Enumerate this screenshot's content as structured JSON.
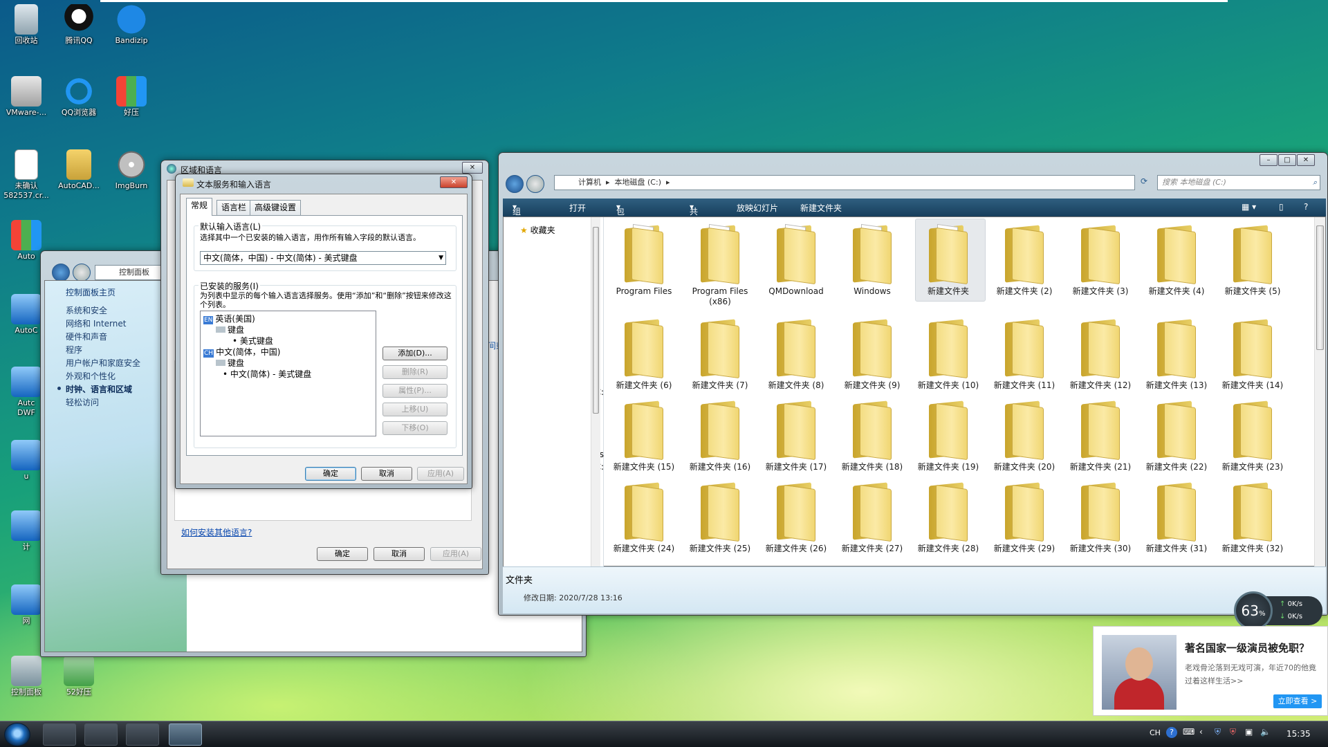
{
  "desktop": {
    "icons": [
      {
        "label": "回收站",
        "icon": "recycle-bin-icon"
      },
      {
        "label": "腾讯QQ",
        "icon": "qq-icon"
      },
      {
        "label": "Bandizip",
        "icon": "bandizip-icon"
      },
      {
        "label": "VMware-...",
        "icon": "vmware-icon"
      },
      {
        "label": "QQ浏览器",
        "icon": "qq-browser-icon"
      },
      {
        "label": "好压",
        "icon": "haozip-icon"
      },
      {
        "label": "未确认\n582537.cr...",
        "icon": "document-icon"
      },
      {
        "label": "AutoCAD...",
        "icon": "autocad-folder-icon"
      },
      {
        "label": "ImgBurn",
        "icon": "imgburn-icon"
      },
      {
        "label": "Auto",
        "icon": "autocad-icon"
      },
      {
        "label": "AutoC",
        "icon": "autocad-icon"
      },
      {
        "label": "Autc\nDWF",
        "icon": "dwf-icon"
      },
      {
        "label": "u",
        "icon": "app-icon"
      },
      {
        "label": "计",
        "icon": "computer-icon"
      },
      {
        "label": "网",
        "icon": "network-icon"
      },
      {
        "label": "控制面板",
        "icon": "control-panel-icon"
      },
      {
        "label": "52好压",
        "icon": "haozip-icon"
      }
    ]
  },
  "control_panel": {
    "address": "控制面板",
    "sidebar": [
      {
        "label": "控制面板主页"
      },
      {
        "label": "系统和安全"
      },
      {
        "label": "网络和 Internet"
      },
      {
        "label": "硬件和声音"
      },
      {
        "label": "程序"
      },
      {
        "label": "用户帐户和家庭安全"
      },
      {
        "label": "外观和个性化"
      },
      {
        "label": "时钟、语言和区域"
      },
      {
        "label": "轻松访问"
      }
    ],
    "link_fragment": "间或数字格式"
  },
  "region_dialog": {
    "title": "区域和语言",
    "link": "如何安装其他语言?",
    "ok": "确定",
    "cancel": "取消",
    "apply": "应用(A)"
  },
  "text_services": {
    "title": "文本服务和输入语言",
    "tabs": [
      "常规",
      "语言栏",
      "高级键设置"
    ],
    "default_group": "默认输入语言(L)",
    "default_desc": "选择其中一个已安装的输入语言，用作所有输入字段的默认语言。",
    "default_value": "中文(简体，中国) - 中文(简体) - 美式键盘",
    "installed_group": "已安装的服务(I)",
    "installed_desc": "为列表中显示的每个输入语言选择服务。使用“添加”和“删除”按钮来修改这个列表。",
    "tree": [
      {
        "text": "英语(美国)",
        "flag": "EN"
      },
      {
        "text": "键盘"
      },
      {
        "text": "美式键盘"
      },
      {
        "text": "中文(简体，中国)",
        "flag": "CH"
      },
      {
        "text": "键盘"
      },
      {
        "text": "中文(简体) - 美式键盘"
      }
    ],
    "buttons": {
      "add": "添加(D)...",
      "remove": "删除(R)",
      "properties": "属性(P)...",
      "move_up": "上移(U)",
      "move_down": "下移(O)"
    },
    "ok": "确定",
    "cancel": "取消",
    "apply": "应用(A)"
  },
  "explorer": {
    "breadcrumb": [
      "计算机",
      "本地磁盘 (C:)"
    ],
    "search_placeholder": "搜索 本地磁盘 (C:)",
    "toolbar": [
      "组织",
      "打开",
      "包含到库中",
      "共享",
      "放映幻灯片",
      "新建文件夹"
    ],
    "nav": {
      "favorites": "收藏夹",
      "fragments": [
        "置",
        "(C:",
        "les",
        "(C:"
      ]
    },
    "folders": [
      "Program Files",
      "Program Files\n(x86)",
      "QMDownload",
      "Windows",
      "新建文件夹",
      "新建文件夹 (2)",
      "新建文件夹 (3)",
      "新建文件夹 (4)",
      "新建文件夹 (5)",
      "新建文件夹 (6)",
      "新建文件夹 (7)",
      "新建文件夹 (8)",
      "新建文件夹 (9)",
      "新建文件夹 (10)",
      "新建文件夹 (11)",
      "新建文件夹 (12)",
      "新建文件夹 (13)",
      "新建文件夹 (14)",
      "新建文件夹 (15)",
      "新建文件夹 (16)",
      "新建文件夹 (17)",
      "新建文件夹 (18)",
      "新建文件夹 (19)",
      "新建文件夹 (20)",
      "新建文件夹 (21)",
      "新建文件夹 (22)",
      "新建文件夹 (23)",
      "新建文件夹 (24)",
      "新建文件夹 (25)",
      "新建文件夹 (26)",
      "新建文件夹 (27)",
      "新建文件夹 (28)",
      "新建文件夹 (29)",
      "新建文件夹 (30)",
      "新建文件夹 (31)",
      "新建文件夹 (32)"
    ],
    "details": {
      "name": "文件夹",
      "modified": "修改日期: 2020/7/28 13:16"
    }
  },
  "speed_widget": {
    "percent": "63",
    "unit": "%",
    "up": "0K/s",
    "down": "0K/s"
  },
  "ad": {
    "headline": "著名国家一级演员被免职？",
    "desc": "老戏骨沦落到无戏可演，年近70的他竟过着这样生活>>",
    "cta": "立即查看 >"
  },
  "taskbar": {
    "lang": "CH",
    "time": "15:35"
  }
}
